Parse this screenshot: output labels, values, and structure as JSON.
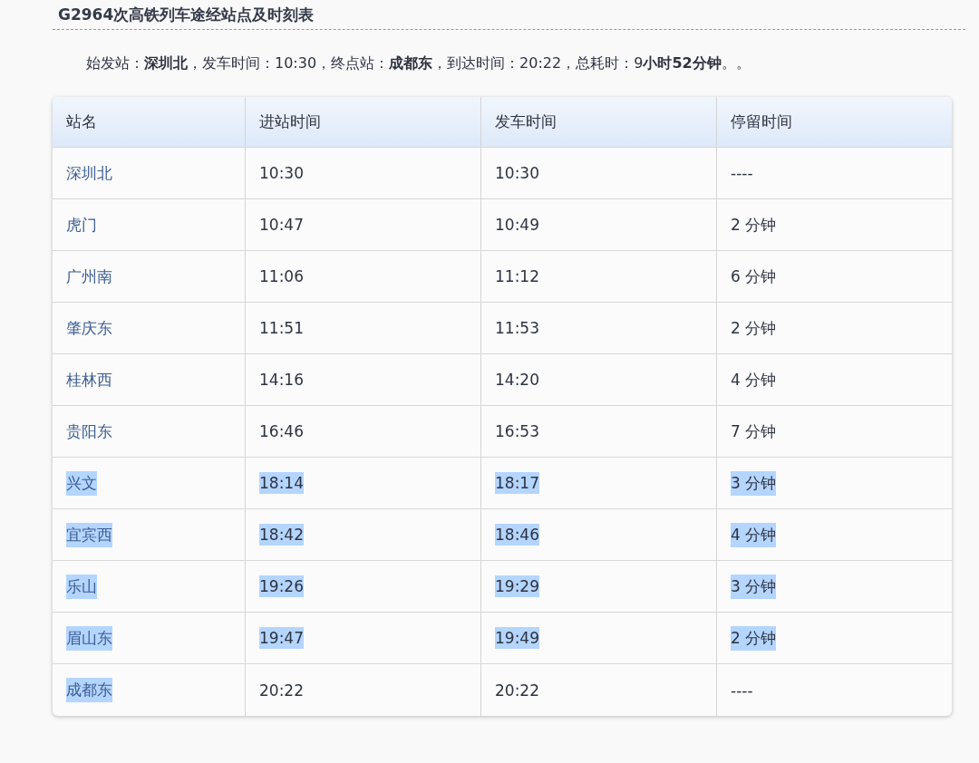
{
  "title": "G2964次高铁列车途经站点及时刻表",
  "summary": "始发站：**深圳北**，发车时间：10:30，终点站：**成都东**，到达时间：20:22，总耗时：9**小时52分钟**。。",
  "table": {
    "columns": [
      "站名",
      "进站时间",
      "发车时间",
      "停留时间"
    ],
    "rows": [
      [
        {
          "text": "深圳北",
          "selected": false
        },
        {
          "text": "10:30",
          "selected": false
        },
        {
          "text": "10:30",
          "selected": false
        },
        {
          "text": "----",
          "selected": false
        }
      ],
      [
        {
          "text": "虎门",
          "selected": false
        },
        {
          "text": "10:47",
          "selected": false
        },
        {
          "text": "10:49",
          "selected": false
        },
        {
          "text": "2 分钟",
          "selected": false
        }
      ],
      [
        {
          "text": "广州南",
          "selected": false
        },
        {
          "text": "11:06",
          "selected": false
        },
        {
          "text": "11:12",
          "selected": false
        },
        {
          "text": "6 分钟",
          "selected": false
        }
      ],
      [
        {
          "text": "肇庆东",
          "selected": false
        },
        {
          "text": "11:51",
          "selected": false
        },
        {
          "text": "11:53",
          "selected": false
        },
        {
          "text": "2 分钟",
          "selected": false
        }
      ],
      [
        {
          "text": "桂林西",
          "selected": false
        },
        {
          "text": "14:16",
          "selected": false
        },
        {
          "text": "14:20",
          "selected": false
        },
        {
          "text": "4 分钟",
          "selected": false
        }
      ],
      [
        {
          "text": "贵阳东",
          "selected": false
        },
        {
          "text": "16:46",
          "selected": false
        },
        {
          "text": "16:53",
          "selected": false
        },
        {
          "text": "7 分钟",
          "selected": false
        }
      ],
      [
        {
          "text": "兴文",
          "selected": true
        },
        {
          "text": "18:14",
          "selected": true
        },
        {
          "text": "18:17",
          "selected": true
        },
        {
          "text": "3 分钟",
          "selected": true
        }
      ],
      [
        {
          "text": "宜宾西",
          "selected": true
        },
        {
          "text": "18:42",
          "selected": true
        },
        {
          "text": "18:46",
          "selected": true
        },
        {
          "text": "4 分钟",
          "selected": true
        }
      ],
      [
        {
          "text": "乐山",
          "selected": true
        },
        {
          "text": "19:26",
          "selected": true
        },
        {
          "text": "19:29",
          "selected": true
        },
        {
          "text": "3 分钟",
          "selected": true
        }
      ],
      [
        {
          "text": "眉山东",
          "selected": true
        },
        {
          "text": "19:47",
          "selected": true
        },
        {
          "text": "19:49",
          "selected": true
        },
        {
          "text": "2 分钟",
          "selected": true
        }
      ],
      [
        {
          "text": "成都东",
          "selected": true
        },
        {
          "text": "20:22",
          "selected": false
        },
        {
          "text": "20:22",
          "selected": false
        },
        {
          "text": "----",
          "selected": false
        }
      ]
    ]
  }
}
